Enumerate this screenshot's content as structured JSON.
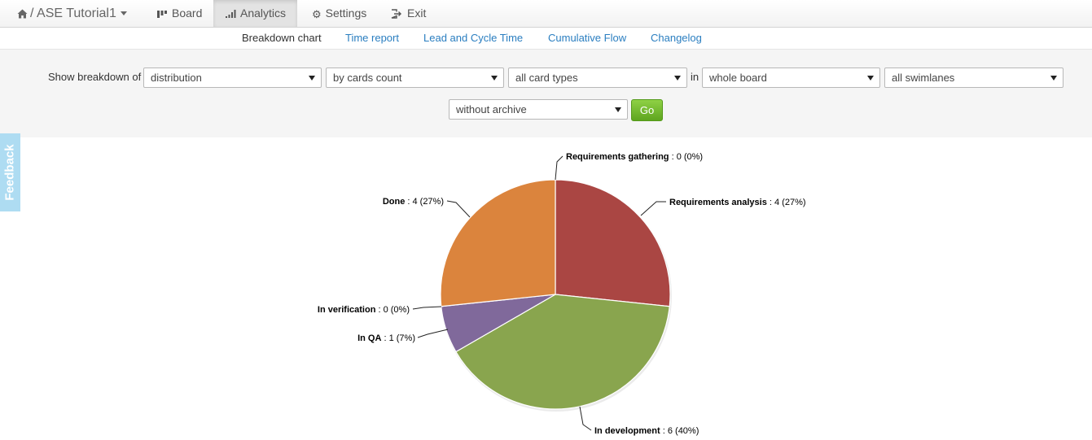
{
  "navbar": {
    "project": "ASE Tutorial1",
    "separator": "/",
    "items": [
      {
        "label": "Board",
        "icon": "board-icon"
      },
      {
        "label": "Analytics",
        "icon": "signal-bars-icon"
      },
      {
        "label": "Settings",
        "icon": "gear-icon"
      },
      {
        "label": "Exit",
        "icon": "exit-icon"
      }
    ]
  },
  "subnav": {
    "tabs": [
      {
        "label": "Breakdown chart"
      },
      {
        "label": "Time report"
      },
      {
        "label": "Lead and Cycle Time"
      },
      {
        "label": "Cumulative Flow"
      },
      {
        "label": "Changelog"
      }
    ]
  },
  "filters": {
    "show_label": "Show breakdown of",
    "in_label": "in",
    "breakdown": "distribution",
    "measure": "by cards count",
    "card_types": "all card types",
    "scope": "whole board",
    "swimlanes": "all swimlanes",
    "archive": "without archive",
    "go_label": "Go"
  },
  "feedback": {
    "label": "Feedback"
  },
  "chart_data": {
    "type": "pie",
    "labels": [
      "Requirements gathering",
      "Requirements analysis",
      "In development",
      "In QA",
      "In verification",
      "Done"
    ],
    "values": [
      0,
      4,
      6,
      1,
      0,
      4
    ],
    "percent_labels": [
      "0%",
      "27%",
      "40%",
      "7%",
      "0%",
      "27%"
    ],
    "colors": [
      "#4572a7",
      "#aa4643",
      "#89a54e",
      "#80699b",
      "#3d96ae",
      "#db843d"
    ]
  }
}
